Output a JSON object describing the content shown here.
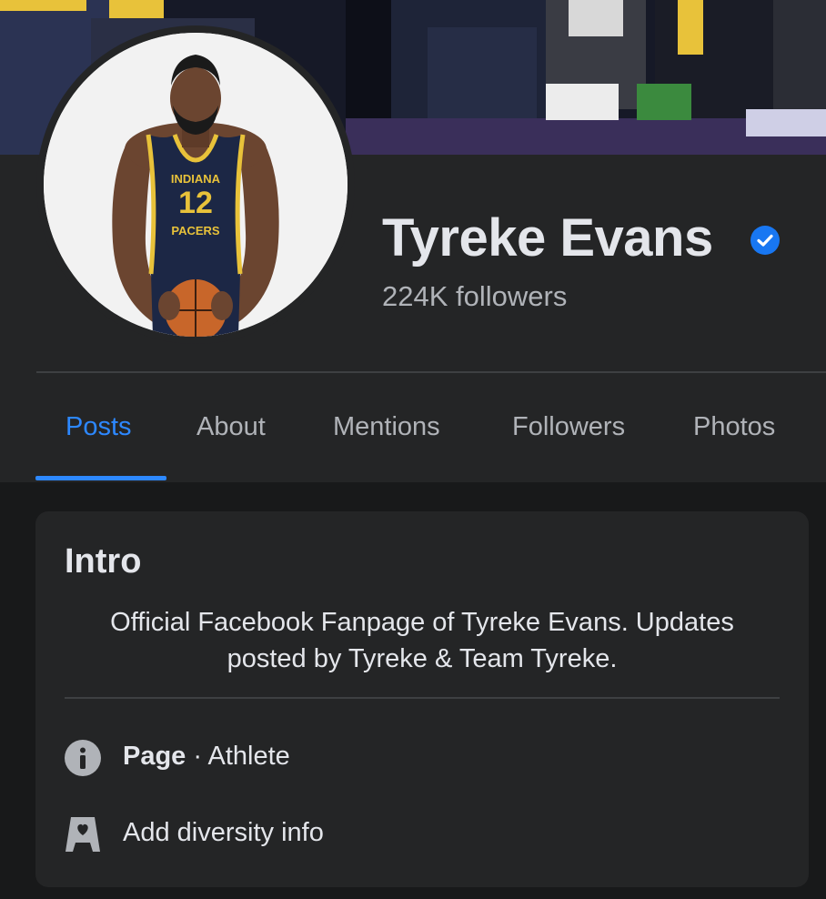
{
  "profile": {
    "name": "Tyreke Evans",
    "followers": "224K followers",
    "jersey": {
      "team_top": "INDIANA",
      "number": "12",
      "team_bottom": "PACERS"
    }
  },
  "tabs": [
    {
      "label": "Posts",
      "active": true
    },
    {
      "label": "About",
      "active": false
    },
    {
      "label": "Mentions",
      "active": false
    },
    {
      "label": "Followers",
      "active": false
    },
    {
      "label": "Photos",
      "active": false
    }
  ],
  "intro": {
    "title": "Intro",
    "bio_line1": "Official Facebook Fanpage of Tyreke Evans. Updates",
    "bio_line2": "posted by Tyreke & Team Tyreke.",
    "page_label": "Page",
    "page_separator": " · ",
    "page_category": "Athlete",
    "diversity_label": "Add diversity info"
  },
  "icons": {
    "verified": "verified-badge-icon",
    "info": "info-icon",
    "diversity": "diversity-heart-icon"
  },
  "colors": {
    "accent": "#2d88ff",
    "background": "#18191a",
    "card": "#242526",
    "text_primary": "#e4e6eb",
    "text_secondary": "#b0b3b8",
    "verified": "#1877f2"
  }
}
